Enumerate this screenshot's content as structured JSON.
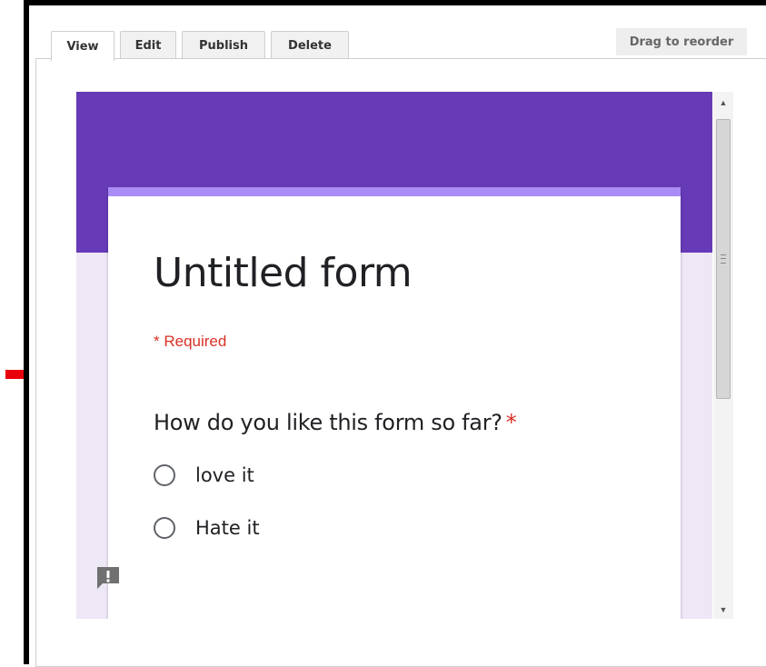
{
  "tabs": [
    {
      "label": "View",
      "active": true
    },
    {
      "label": "Edit"
    },
    {
      "label": "Publish"
    },
    {
      "label": "Delete"
    }
  ],
  "drag_label": "Drag to reorder",
  "form": {
    "title": "Untitled form",
    "required_note": "* Required",
    "question": {
      "text": "How do you like this form so far?",
      "required_mark": "*",
      "options": [
        {
          "label": "love it"
        },
        {
          "label": "Hate it"
        }
      ]
    }
  },
  "icons": {
    "feedback": "feedback-icon",
    "annotation": "red-arrow-icon",
    "scroll_up": "scroll-up-arrow-icon",
    "scroll_down": "scroll-down-arrow-icon"
  },
  "colors": {
    "banner": "#673ab7",
    "card_accent": "#a98cf5",
    "background": "#ede7f6",
    "required": "#d93025",
    "annotation_arrow": "#e8000b"
  }
}
